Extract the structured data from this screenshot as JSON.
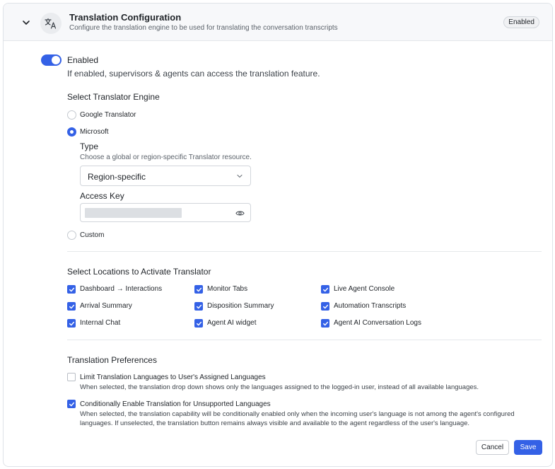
{
  "header": {
    "title": "Translation Configuration",
    "subtitle": "Configure the translation engine to be used for translating the conversation transcripts",
    "status": "Enabled",
    "icon": "translate-icon"
  },
  "toggle": {
    "label": "Enabled",
    "description": "If enabled, supervisors & agents can access the translation feature.",
    "on": true
  },
  "engine": {
    "title": "Select Translator Engine",
    "options": [
      {
        "label": "Google Translator",
        "checked": false
      },
      {
        "label": "Microsoft",
        "checked": true
      },
      {
        "label": "Custom",
        "checked": false
      }
    ],
    "type_label": "Type",
    "type_description": "Choose a global or region-specific Translator resource.",
    "type_value": "Region-specific",
    "access_key_label": "Access Key"
  },
  "locations": {
    "title": "Select Locations to Activate Translator",
    "items": [
      {
        "label": "Dashboard → Interactions",
        "checked": true
      },
      {
        "label": "Monitor Tabs",
        "checked": true
      },
      {
        "label": "Live Agent Console",
        "checked": true
      },
      {
        "label": "Arrival Summary",
        "checked": true
      },
      {
        "label": "Disposition Summary",
        "checked": true
      },
      {
        "label": "Automation Transcripts",
        "checked": true
      },
      {
        "label": "Internal Chat",
        "checked": true
      },
      {
        "label": "Agent AI widget",
        "checked": true
      },
      {
        "label": "Agent AI Conversation Logs",
        "checked": true
      }
    ]
  },
  "preferences": {
    "title": "Translation Preferences",
    "items": [
      {
        "label": "Limit Translation Languages to User's Assigned Languages",
        "description": "When selected, the translation drop down shows only the languages assigned to the logged-in user, instead of all available languages.",
        "checked": false
      },
      {
        "label": "Conditionally Enable Translation for Unsupported Languages",
        "description": "When selected, the translation capability will be conditionally enabled only when the incoming user's language is not among the agent's configured languages. If unselected, the translation button remains always visible and available to the agent regardless of the user's language.",
        "checked": true
      }
    ]
  },
  "actions": {
    "cancel": "Cancel",
    "save": "Save"
  },
  "colors": {
    "accent": "#3461e6",
    "border": "#dfe3e8",
    "header_bg": "#f7f8fa"
  }
}
